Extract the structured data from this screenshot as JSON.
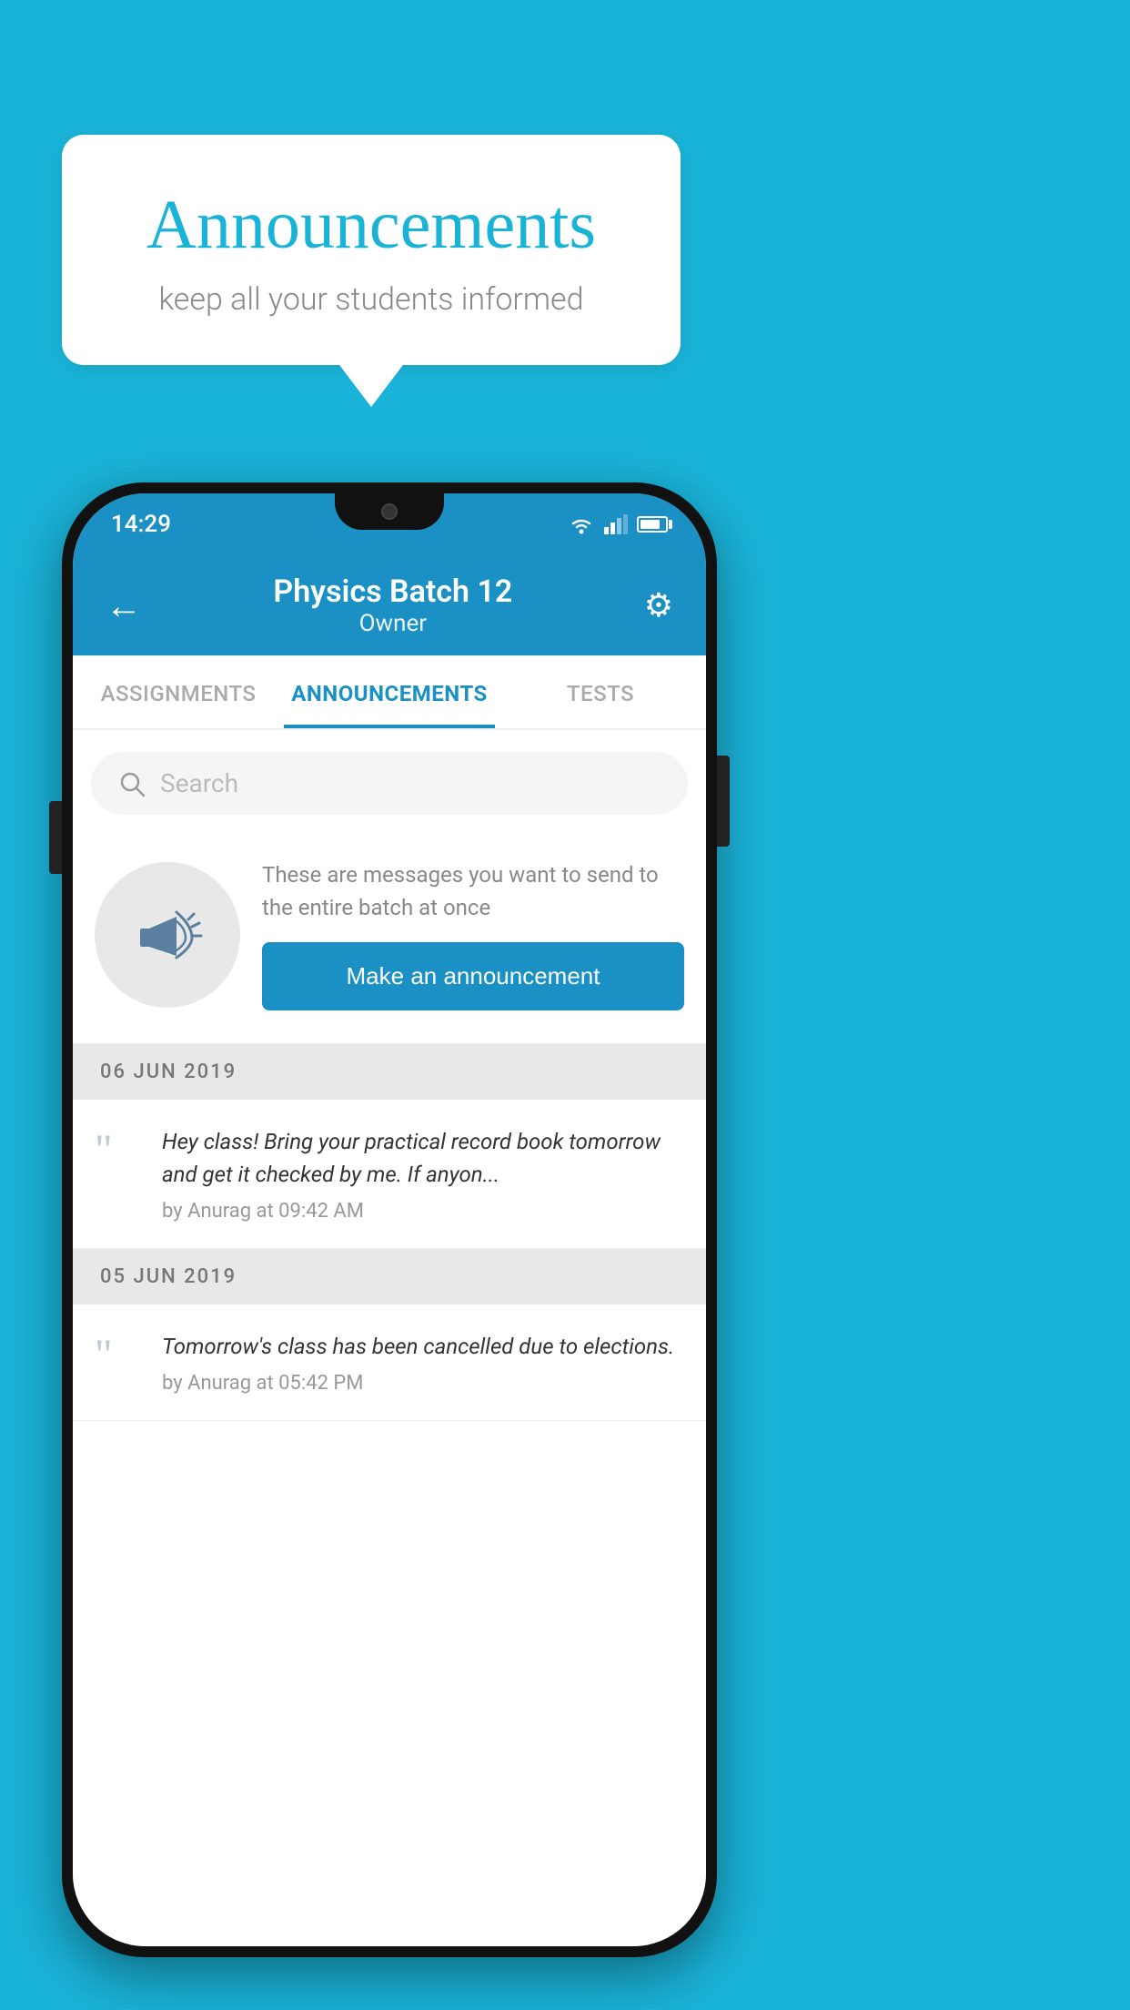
{
  "background_color": "#1ab3d8",
  "speech_bubble": {
    "title": "Announcements",
    "subtitle": "keep all your students informed"
  },
  "phone": {
    "status_bar": {
      "time": "14:29"
    },
    "app_bar": {
      "title": "Physics Batch 12",
      "subtitle": "Owner",
      "back_label": "←",
      "settings_label": "⚙"
    },
    "tabs": [
      {
        "label": "ASSIGNMENTS",
        "active": false
      },
      {
        "label": "ANNOUNCEMENTS",
        "active": true
      },
      {
        "label": "TESTS",
        "active": false
      }
    ],
    "search": {
      "placeholder": "Search"
    },
    "promo": {
      "description": "These are messages you want to send to the entire batch at once",
      "button_label": "Make an announcement"
    },
    "date_groups": [
      {
        "date": "06  JUN  2019",
        "items": [
          {
            "text": "Hey class! Bring your practical record book tomorrow and get it checked by me. If anyon...",
            "meta": "by Anurag at 09:42 AM"
          }
        ]
      },
      {
        "date": "05  JUN  2019",
        "items": [
          {
            "text": "Tomorrow's class has been cancelled due to elections.",
            "meta": "by Anurag at 05:42 PM"
          }
        ]
      }
    ]
  }
}
